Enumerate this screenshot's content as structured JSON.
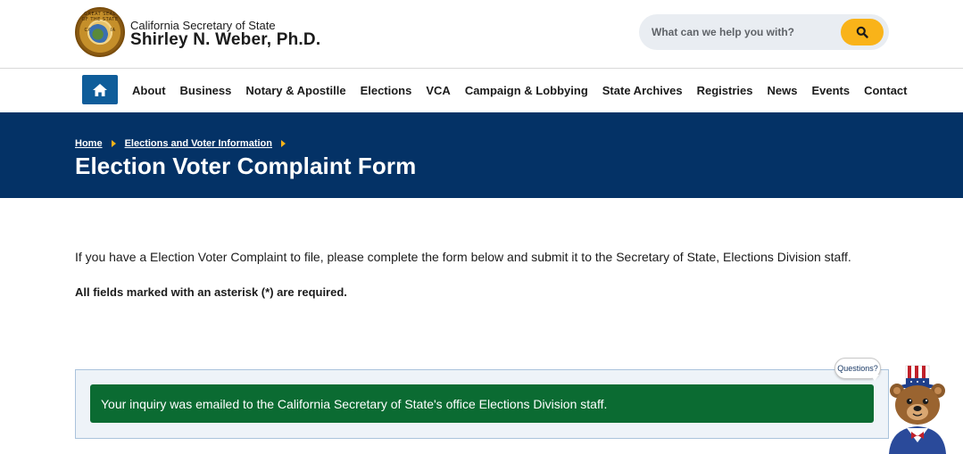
{
  "header": {
    "office": "California Secretary of State",
    "person": "Shirley N. Weber, Ph.D.",
    "seal_text": "GREAT SEAL OF THE STATE OF CALIFORNIA"
  },
  "search": {
    "placeholder": "What can we help you with?"
  },
  "nav": {
    "home_icon": "home-icon",
    "items": [
      "About",
      "Business",
      "Notary & Apostille",
      "Elections",
      "VCA",
      "Campaign & Lobbying",
      "State Archives",
      "Registries",
      "News",
      "Events",
      "Contact"
    ]
  },
  "breadcrumb": {
    "home": "Home",
    "section": "Elections and Voter Information"
  },
  "page": {
    "title": "Election Voter Complaint Form",
    "intro": "If you have a Election Voter Complaint to file, please complete the form below and submit it to the Secretary of State, Elections Division staff.",
    "required_prefix": "All fields marked with an asterisk (",
    "required_mark": "*",
    "required_suffix": ") are required."
  },
  "alert": {
    "message": "Your inquiry was emailed to the California Secretary of State's office Elections Division staff."
  },
  "chat": {
    "bubble": "Questions?"
  },
  "colors": {
    "hero_bg": "#043266",
    "accent": "#f9b319",
    "home_button": "#0f5d9a",
    "success": "#0b6b32"
  }
}
